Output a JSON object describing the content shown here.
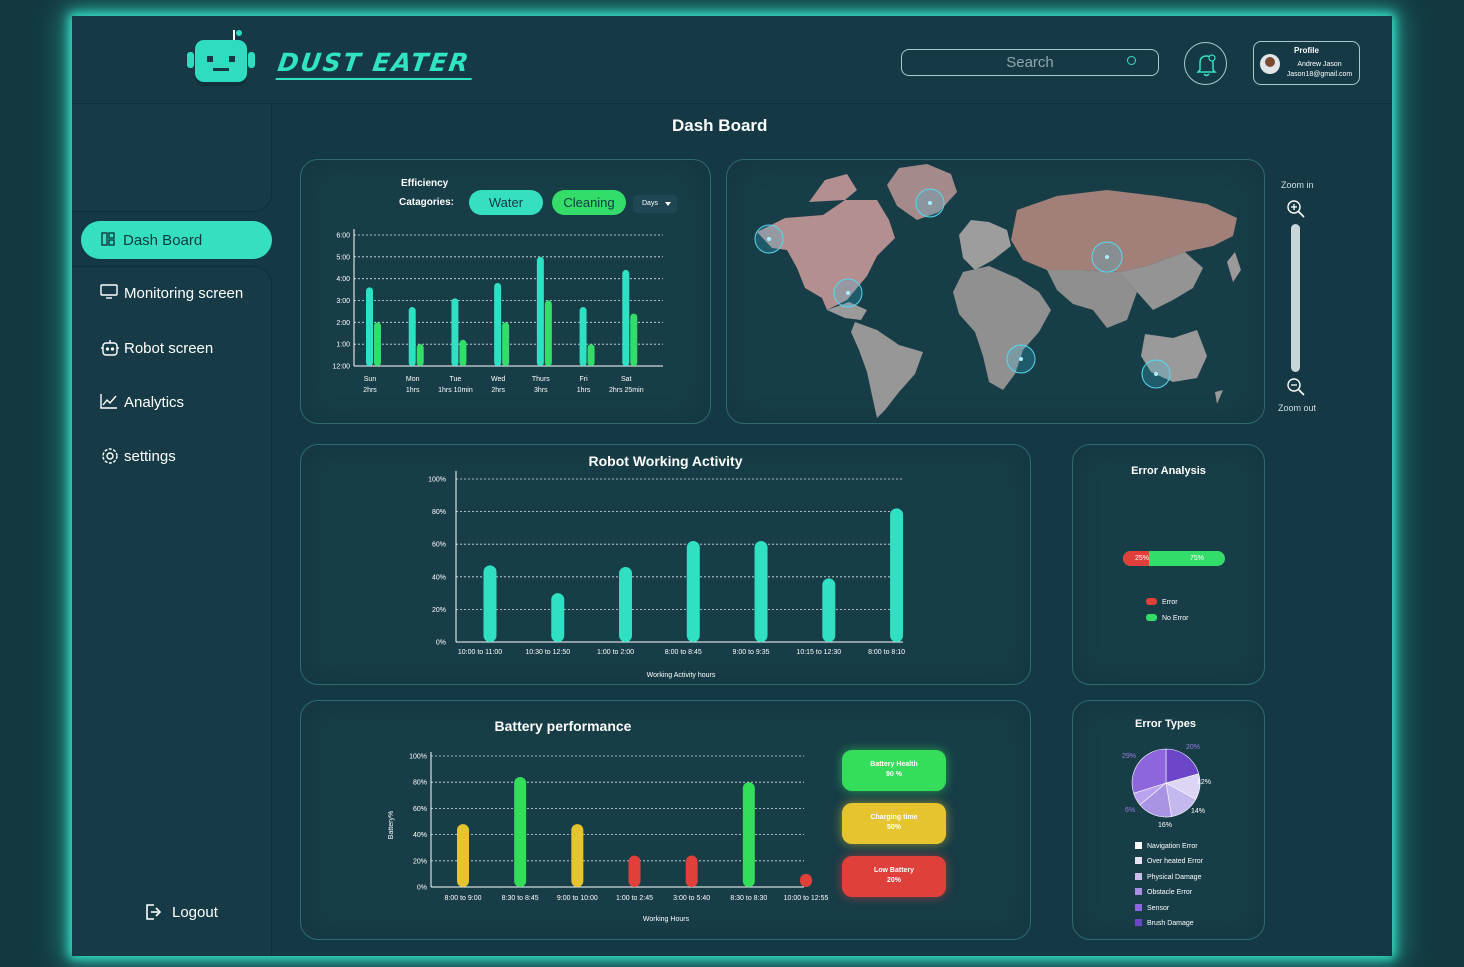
{
  "brand": {
    "name": "DUST EATER",
    "accent": "#31e3c1"
  },
  "search": {
    "placeholder": "Search",
    "icon": "search-icon"
  },
  "profile": {
    "title": "Profile",
    "name": "Andrew Jason",
    "email": "Jason18@gmail.com"
  },
  "page": {
    "title": "Dash Board"
  },
  "sidebar": {
    "items": [
      {
        "label": "Dash Board",
        "icon": "dashboard-icon",
        "active": true
      },
      {
        "label": "Monitoring screen",
        "icon": "monitor-icon"
      },
      {
        "label": "Robot screen",
        "icon": "robot-icon"
      },
      {
        "label": "Analytics",
        "icon": "analytics-icon"
      },
      {
        "label": "settings",
        "icon": "gear-icon"
      }
    ],
    "logout": "Logout"
  },
  "efficiency": {
    "title": "Efficiency",
    "categories_label": "Catagories:",
    "water": "Water",
    "cleaning": "Cleaning",
    "days": "Days"
  },
  "map": {
    "zoom_in": "Zoom in",
    "zoom_out": "Zoom out"
  },
  "activity": {
    "title": "Robot Working Activity"
  },
  "error_analysis": {
    "title": "Error Analysis",
    "error_pct": "25%",
    "no_error_pct": "75%",
    "error_value": 0.25,
    "legend": [
      "Error",
      "No Error"
    ]
  },
  "battery": {
    "title": "Battery performance",
    "health_label": "Battery Health",
    "health_value": "90 %",
    "charging_label": "Charging time",
    "charging_value": "50%",
    "low_label": "Low Battery",
    "low_value": "20%"
  },
  "error_types": {
    "title": "Error Types",
    "legend": [
      "Navigation Error",
      "Over heated Error",
      "Physical Damage",
      "Obstacle Error",
      "Sensor",
      "Brush Damage"
    ]
  },
  "chart_data": [
    {
      "type": "bar",
      "categories": [
        "Sun",
        "Mon",
        "Tue",
        "Wed",
        "Thurs",
        "Fri",
        "Sat"
      ],
      "sublabels": [
        "2hrs",
        "1hrs",
        "1hrs 10min",
        "2hrs",
        "3hrs",
        "1hrs",
        "2hrs 25min"
      ],
      "yticks": [
        "12:00",
        "1:00",
        "2:00",
        "3:00",
        "4:00",
        "5:00",
        "6:00"
      ],
      "ylim": [
        0,
        6
      ],
      "series": [
        {
          "name": "Water",
          "color": "#2fe0c2",
          "values": [
            3.6,
            2.7,
            3.1,
            3.8,
            5.0,
            2.7,
            4.4
          ]
        },
        {
          "name": "Cleaning",
          "color": "#34dd6a",
          "values": [
            2.0,
            1.0,
            1.2,
            2.0,
            3.0,
            1.0,
            2.4
          ]
        }
      ],
      "grid": true
    },
    {
      "type": "bar",
      "title": "Robot Working Activity",
      "categories": [
        "10:00 to 11:00",
        "10:30 to 12:50",
        "1:00 to 2:00",
        "8:00 to 8:45",
        "9:00 to 9:35",
        "10:15 to 12:30",
        "8:00 to 8:10"
      ],
      "values": [
        47,
        30,
        46,
        62,
        62,
        39,
        82
      ],
      "yticks": [
        "0%",
        "20%",
        "40%",
        "60%",
        "80%",
        "100%"
      ],
      "ylim": [
        0,
        100
      ],
      "xlabel": "Working Activity hours",
      "color": "#2fe0c2",
      "grid": true
    },
    {
      "type": "bar",
      "title": "Battery performance",
      "categories": [
        "8:00 to 9:00",
        "8:30 to 8:45",
        "9:00 to 10:00",
        "1:00 to 2:45",
        "3:00 to 5:40",
        "8:30 to 8:30",
        "10:00 to 12:55"
      ],
      "values": [
        48,
        84,
        48,
        24,
        24,
        80,
        10
      ],
      "colors": [
        "#e5c42f",
        "#34dd5a",
        "#e5c42f",
        "#e0403a",
        "#e0403a",
        "#34dd5a",
        "#e0403a"
      ],
      "yticks": [
        "0%",
        "20%",
        "40%",
        "60%",
        "80%",
        "100%"
      ],
      "ylim": [
        0,
        100
      ],
      "xlabel": "Working Hours",
      "ylabel": "Battery%",
      "grid": true
    },
    {
      "type": "pie",
      "title": "Error Types",
      "labels": [
        "20%",
        "12%",
        "14%",
        "16%",
        "6%",
        "29%"
      ],
      "values": [
        20,
        12,
        14,
        16,
        6,
        29
      ],
      "colors": [
        "#6c45c9",
        "#dcd6f4",
        "#c5b8ee",
        "#a993e3",
        "#b9a3f0",
        "#8d66dc"
      ]
    }
  ]
}
